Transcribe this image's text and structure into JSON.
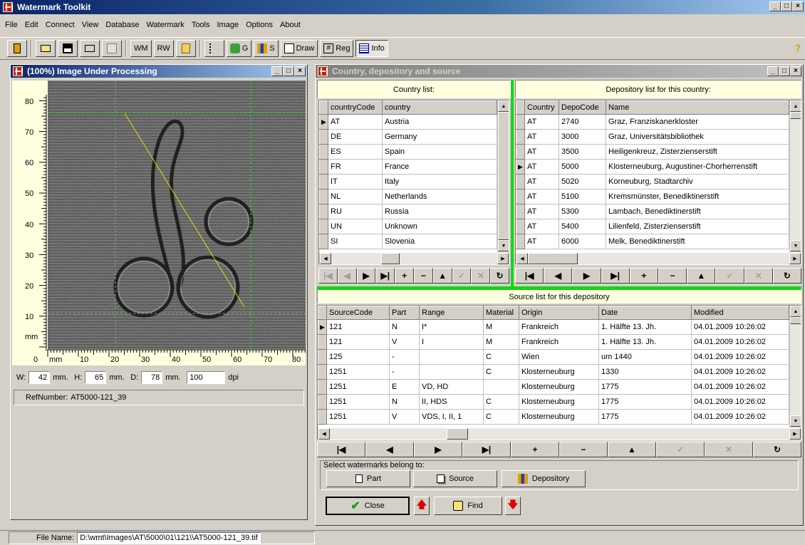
{
  "app": {
    "title": "Watermark Toolkit",
    "win_btns": [
      "_",
      "□",
      "×"
    ]
  },
  "menu": [
    "File",
    "Edit",
    "Connect",
    "View",
    "Database",
    "Watermark",
    "Tools",
    "Image",
    "Options",
    "About"
  ],
  "toolbar": {
    "wm": "WM",
    "rw": "RW",
    "g": "G",
    "s": "S",
    "draw": "Draw",
    "reg": "Reg",
    "info": "Info",
    "help": "?"
  },
  "image_window": {
    "title": "(100%) Image Under Processing",
    "ruler_v": [
      "80",
      "70",
      "60",
      "50",
      "40",
      "30",
      "20",
      "10",
      "mm"
    ],
    "ruler_h": [
      "0",
      "mm",
      "10",
      "20",
      "30",
      "40",
      "50",
      "60",
      "70",
      "80"
    ],
    "w_label": "W:",
    "w_value": "42",
    "w_unit": "mm.",
    "h_label": "H:",
    "h_value": "65",
    "h_unit": "mm.",
    "d_label": "D:",
    "d_value": "78",
    "d_unit": "mm.",
    "dpi_value": "100",
    "dpi_unit": "dpi",
    "ref_label": "RefNumber:",
    "ref_value": "AT5000-121_39"
  },
  "dialog": {
    "title": "Country, depository and source",
    "country_caption": "Country list:",
    "country_headers": [
      "countryCode",
      "country"
    ],
    "countries": [
      [
        "AT",
        "Austria"
      ],
      [
        "DE",
        "Germany"
      ],
      [
        "ES",
        "Spain"
      ],
      [
        "FR",
        "France"
      ],
      [
        "IT",
        "Italy"
      ],
      [
        "NL",
        "Netherlands"
      ],
      [
        "RU",
        "Russia"
      ],
      [
        "UN",
        "Unknown"
      ],
      [
        "SI",
        "Slovenia"
      ]
    ],
    "depo_caption": "Depository list for this country:",
    "depo_headers": [
      "Country",
      "DepoCode",
      "Name"
    ],
    "depos": [
      [
        "AT",
        "2740",
        "Graz, Franziskanerkloster"
      ],
      [
        "AT",
        "3000",
        "Graz, Universitätsbibliothek"
      ],
      [
        "AT",
        "3500",
        "Heiligenkreuz, Zisterzienserstift"
      ],
      [
        "AT",
        "5000",
        "Klosterneuburg, Augustiner-Chorherrenstift"
      ],
      [
        "AT",
        "5020",
        "Korneuburg, Stadtarchiv"
      ],
      [
        "AT",
        "5100",
        "Kremsmünster, Benediktinerstift"
      ],
      [
        "AT",
        "5300",
        "Lambach, Benediktinerstift"
      ],
      [
        "AT",
        "5400",
        "Lilienfeld, Zisterzienserstift"
      ],
      [
        "AT",
        "6000",
        "Melk, Benediktinerstift"
      ]
    ],
    "source_caption": "Source list for this depository",
    "source_headers": [
      "SourceCode",
      "Part",
      "Range",
      "Material",
      "Origin",
      "Date",
      "Modified"
    ],
    "sources": [
      [
        "121",
        "N",
        "I*",
        "M",
        "Frankreich",
        "1. Hälfte 13. Jh.",
        "04.01.2009 10:26:02"
      ],
      [
        "121",
        "V",
        "I",
        "M",
        "Frankreich",
        "1. Hälfte 13. Jh.",
        "04.01.2009 10:26:02"
      ],
      [
        "125",
        "-",
        "",
        "C",
        "Wien",
        "um 1440",
        "04.01.2009 10:26:02"
      ],
      [
        "1251",
        "-",
        "",
        "C",
        "Klosterneuburg",
        "1330",
        "04.01.2009 10:26:02"
      ],
      [
        "1251",
        "E",
        "VD, HD",
        "",
        "Klosterneuburg",
        "1775",
        "04.01.2009 10:26:02"
      ],
      [
        "1251",
        "N",
        "II, HDS",
        "C",
        "Klosterneuburg",
        "1775",
        "04.01.2009 10:26:02"
      ],
      [
        "1251",
        "V",
        "VDS, I, II, 1",
        "C",
        "Klosterneuburg",
        "1775",
        "04.01.2009 10:26:02"
      ]
    ],
    "select_legend": "Select watermarks belong to:",
    "part_btn": "Part",
    "source_btn": "Source",
    "depository_btn": "Depository",
    "close_btn": "Close",
    "find_btn": "Find"
  },
  "status": {
    "label": "File Name:",
    "value": "D:\\wmt\\Images\\AT\\5000\\01\\121\\\\AT5000-121_39.tif"
  }
}
